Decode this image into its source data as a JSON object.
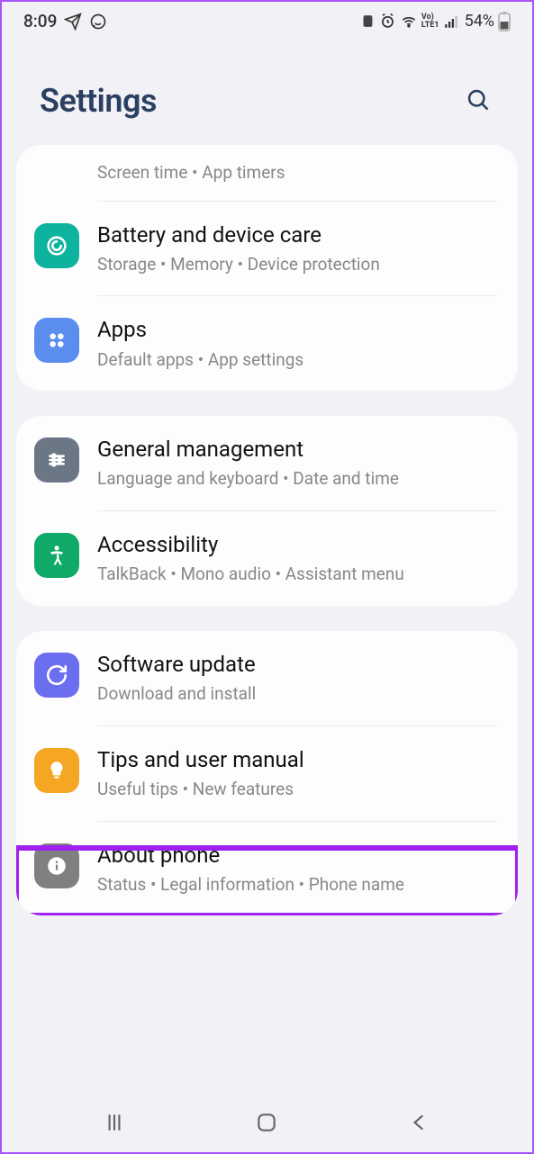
{
  "status": {
    "time": "8:09",
    "battery": "54%"
  },
  "header": {
    "title": "Settings"
  },
  "groups": [
    {
      "items": [
        {
          "partial": true,
          "subtitle": "Screen time  •  App timers"
        },
        {
          "title": "Battery and device care",
          "subtitle": "Storage  •  Memory  •  Device protection",
          "icon": "device-care",
          "color": "#0db39e"
        },
        {
          "title": "Apps",
          "subtitle": "Default apps  •  App settings",
          "icon": "apps",
          "color": "#5b8def"
        }
      ]
    },
    {
      "items": [
        {
          "title": "General management",
          "subtitle": "Language and keyboard  •  Date and time",
          "icon": "general",
          "color": "#6b7785"
        },
        {
          "title": "Accessibility",
          "subtitle": "TalkBack  •  Mono audio  •  Assistant menu",
          "icon": "accessibility",
          "color": "#0fa968"
        }
      ]
    },
    {
      "items": [
        {
          "title": "Software update",
          "subtitle": "Download and install",
          "icon": "update",
          "color": "#6b6eef"
        },
        {
          "title": "Tips and user manual",
          "subtitle": "Useful tips  •  New features",
          "icon": "tips",
          "color": "#f5a623"
        },
        {
          "title": "About phone",
          "subtitle": "Status  •  Legal information  •  Phone name",
          "icon": "about",
          "color": "#808080"
        }
      ]
    }
  ]
}
